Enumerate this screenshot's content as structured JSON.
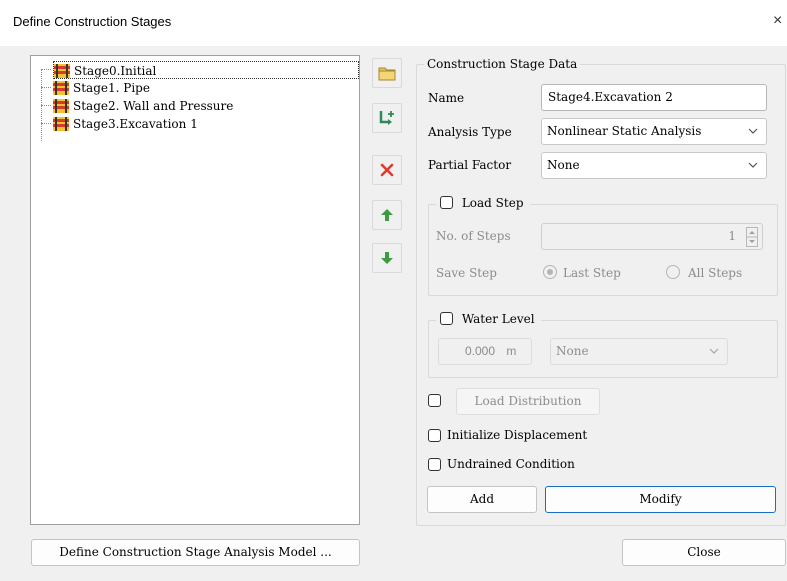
{
  "window": {
    "title": "Define Construction Stages",
    "close_glyph": "×"
  },
  "tree": {
    "items": [
      {
        "label": "Stage0.Initial",
        "selected": true
      },
      {
        "label": "Stage1. Pipe",
        "selected": false
      },
      {
        "label": "Stage2. Wall and Pressure",
        "selected": false
      },
      {
        "label": "Stage3.Excavation 1",
        "selected": false
      }
    ]
  },
  "toolbar": {
    "icons": [
      "folder-icon",
      "add-stage-icon",
      "delete-icon",
      "move-up-icon",
      "move-down-icon"
    ],
    "colors": {
      "folder": "#e8c45a",
      "add": "#2e8b57",
      "delete": "#e03a2f",
      "arrow": "#3d9b41"
    }
  },
  "stage_data": {
    "group_title": "Construction Stage Data",
    "name_label": "Name",
    "name_value": "Stage4.Excavation 2",
    "analysis_label": "Analysis Type",
    "analysis_value": "Nonlinear Static Analysis",
    "partial_label": "Partial Factor",
    "partial_value": "None"
  },
  "load_step": {
    "title": "Load Step",
    "checked": false,
    "steps_label": "No. of Steps",
    "steps_value": "1",
    "save_label": "Save Step",
    "last_step": "Last Step",
    "all_steps": "All Steps"
  },
  "water_level": {
    "title": "Water Level",
    "checked": false,
    "value": "0.000",
    "unit": "m",
    "select_value": "None"
  },
  "options": {
    "load_distribution": "Load Distribution",
    "initialize_displacement": "Initialize Displacement",
    "undrained_condition": "Undrained Condition"
  },
  "buttons": {
    "add": "Add",
    "modify": "Modify",
    "define_model": "Define Construction Stage Analysis Model ...",
    "close": "Close"
  }
}
